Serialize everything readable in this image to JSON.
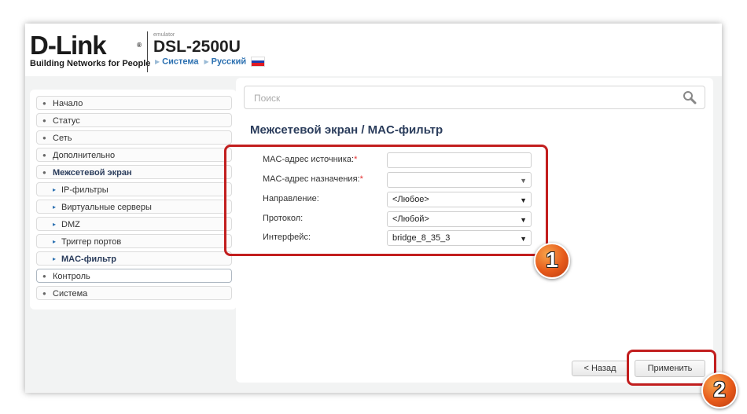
{
  "header": {
    "logo_text": "D-Link",
    "logo_reg": "®",
    "tagline": "Building Networks for People",
    "emulator_label": "emulator",
    "model": "DSL-2500U",
    "crumb_system": "Система",
    "crumb_language": "Русский",
    "flag_colors": [
      "#ffffff",
      "#1d3fae",
      "#e11b22"
    ]
  },
  "sidebar": {
    "items": [
      {
        "label": "Начало"
      },
      {
        "label": "Статус"
      },
      {
        "label": "Сеть"
      },
      {
        "label": "Дополнительно"
      },
      {
        "label": "Межсетевой экран"
      },
      {
        "label": "IP-фильтры"
      },
      {
        "label": "Виртуальные серверы"
      },
      {
        "label": "DMZ"
      },
      {
        "label": "Триггер портов"
      },
      {
        "label": "MAC-фильтр"
      },
      {
        "label": "Контроль"
      },
      {
        "label": "Система"
      }
    ]
  },
  "search": {
    "placeholder": "Поиск",
    "icon": "search-icon"
  },
  "page": {
    "title": "Межсетевой экран /  MAC-фильтр"
  },
  "form": {
    "src_mac_label": "MAC-адрес источника:",
    "src_mac_value": "",
    "dst_mac_label": "MAC-адрес назначения:",
    "dst_mac_value": "",
    "direction_label": "Направление:",
    "direction_value": "<Любое>",
    "protocol_label": "Протокол:",
    "protocol_value": "<Любой>",
    "interface_label": "Интерфейс:",
    "interface_value": "bridge_8_35_3",
    "required_mark": "*"
  },
  "buttons": {
    "back": "< Назад",
    "apply": "Применить"
  },
  "annotations": {
    "badge1": "1",
    "badge2": "2",
    "highlight_color": "#c21e1e",
    "badge_color": "#e6591a"
  },
  "colors": {
    "accent": "#2a6fb0",
    "title": "#2b3d5c"
  }
}
